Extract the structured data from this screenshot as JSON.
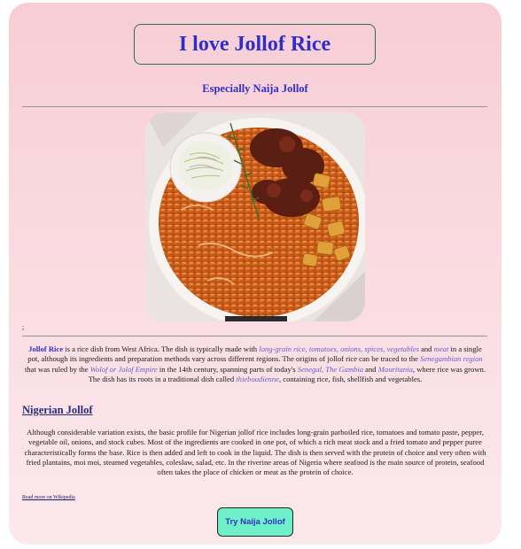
{
  "header": {
    "title": "I love Jollof Rice",
    "subtitle": "Especially Naija Jollof"
  },
  "image": {
    "alt": "Plate of jollof rice with meat, fried plantain and coleslaw"
  },
  "small_mark": ";",
  "intro": {
    "b0": "Jollof Rice",
    "t1": " is a rice dish from West Africa. The dish is typically made with ",
    "i1": "long-grain rice, tomatoes, onions, spices, vegetables",
    "t2": " and ",
    "i2": "meat",
    "t3": " in a single pot, although its ingredients and preparation methods vary across different regions. The origins of jollof rice can be traced to the ",
    "i3": "Senegambian region",
    "t4": " that was ruled by the ",
    "i4": "Wolof or Jolof Empire",
    "t5": " in the 14th century, spanning parts of today's ",
    "i5": "Senegal, The Gambia",
    "t6": " and ",
    "i6": "Mauritania",
    "t7": ", where rice was grown. The dish has its roots in a traditional dish called ",
    "i7": "thieboudienne",
    "t8": ", containing rice, fish, shellfish and vegetables."
  },
  "section": {
    "heading": "Nigerian Jollof",
    "body": "Although considerable variation exists, the basic profile for Nigerian jollof rice includes long-grain parboiled rice, tomatoes and tomato paste, pepper, vegetable oil, onions, and stock cubes. Most of the ingredients are cooked in one pot, of which a rich meat stock and a fried tomato and pepper puree characteristically forms the base. Rice is then added and left to cook in the liquid. The dish is then served with the protein of choice and very often with fried plantains, moi moi, steamed vegetables, coleslaw, salad, etc. In the riverine areas of Nigeria where seafood is the main source of protein, seafood often takes the place of chicken or meat as the protein of choice."
  },
  "links": {
    "wiki": "Read more on Wikipedia"
  },
  "button": {
    "label": "Try Naija Jollof"
  },
  "colors": {
    "heading": "#2f2fc8",
    "button_bg": "#6ff0c8",
    "card_top": "#f8cdd5",
    "card_bottom": "#fbe9ec"
  }
}
